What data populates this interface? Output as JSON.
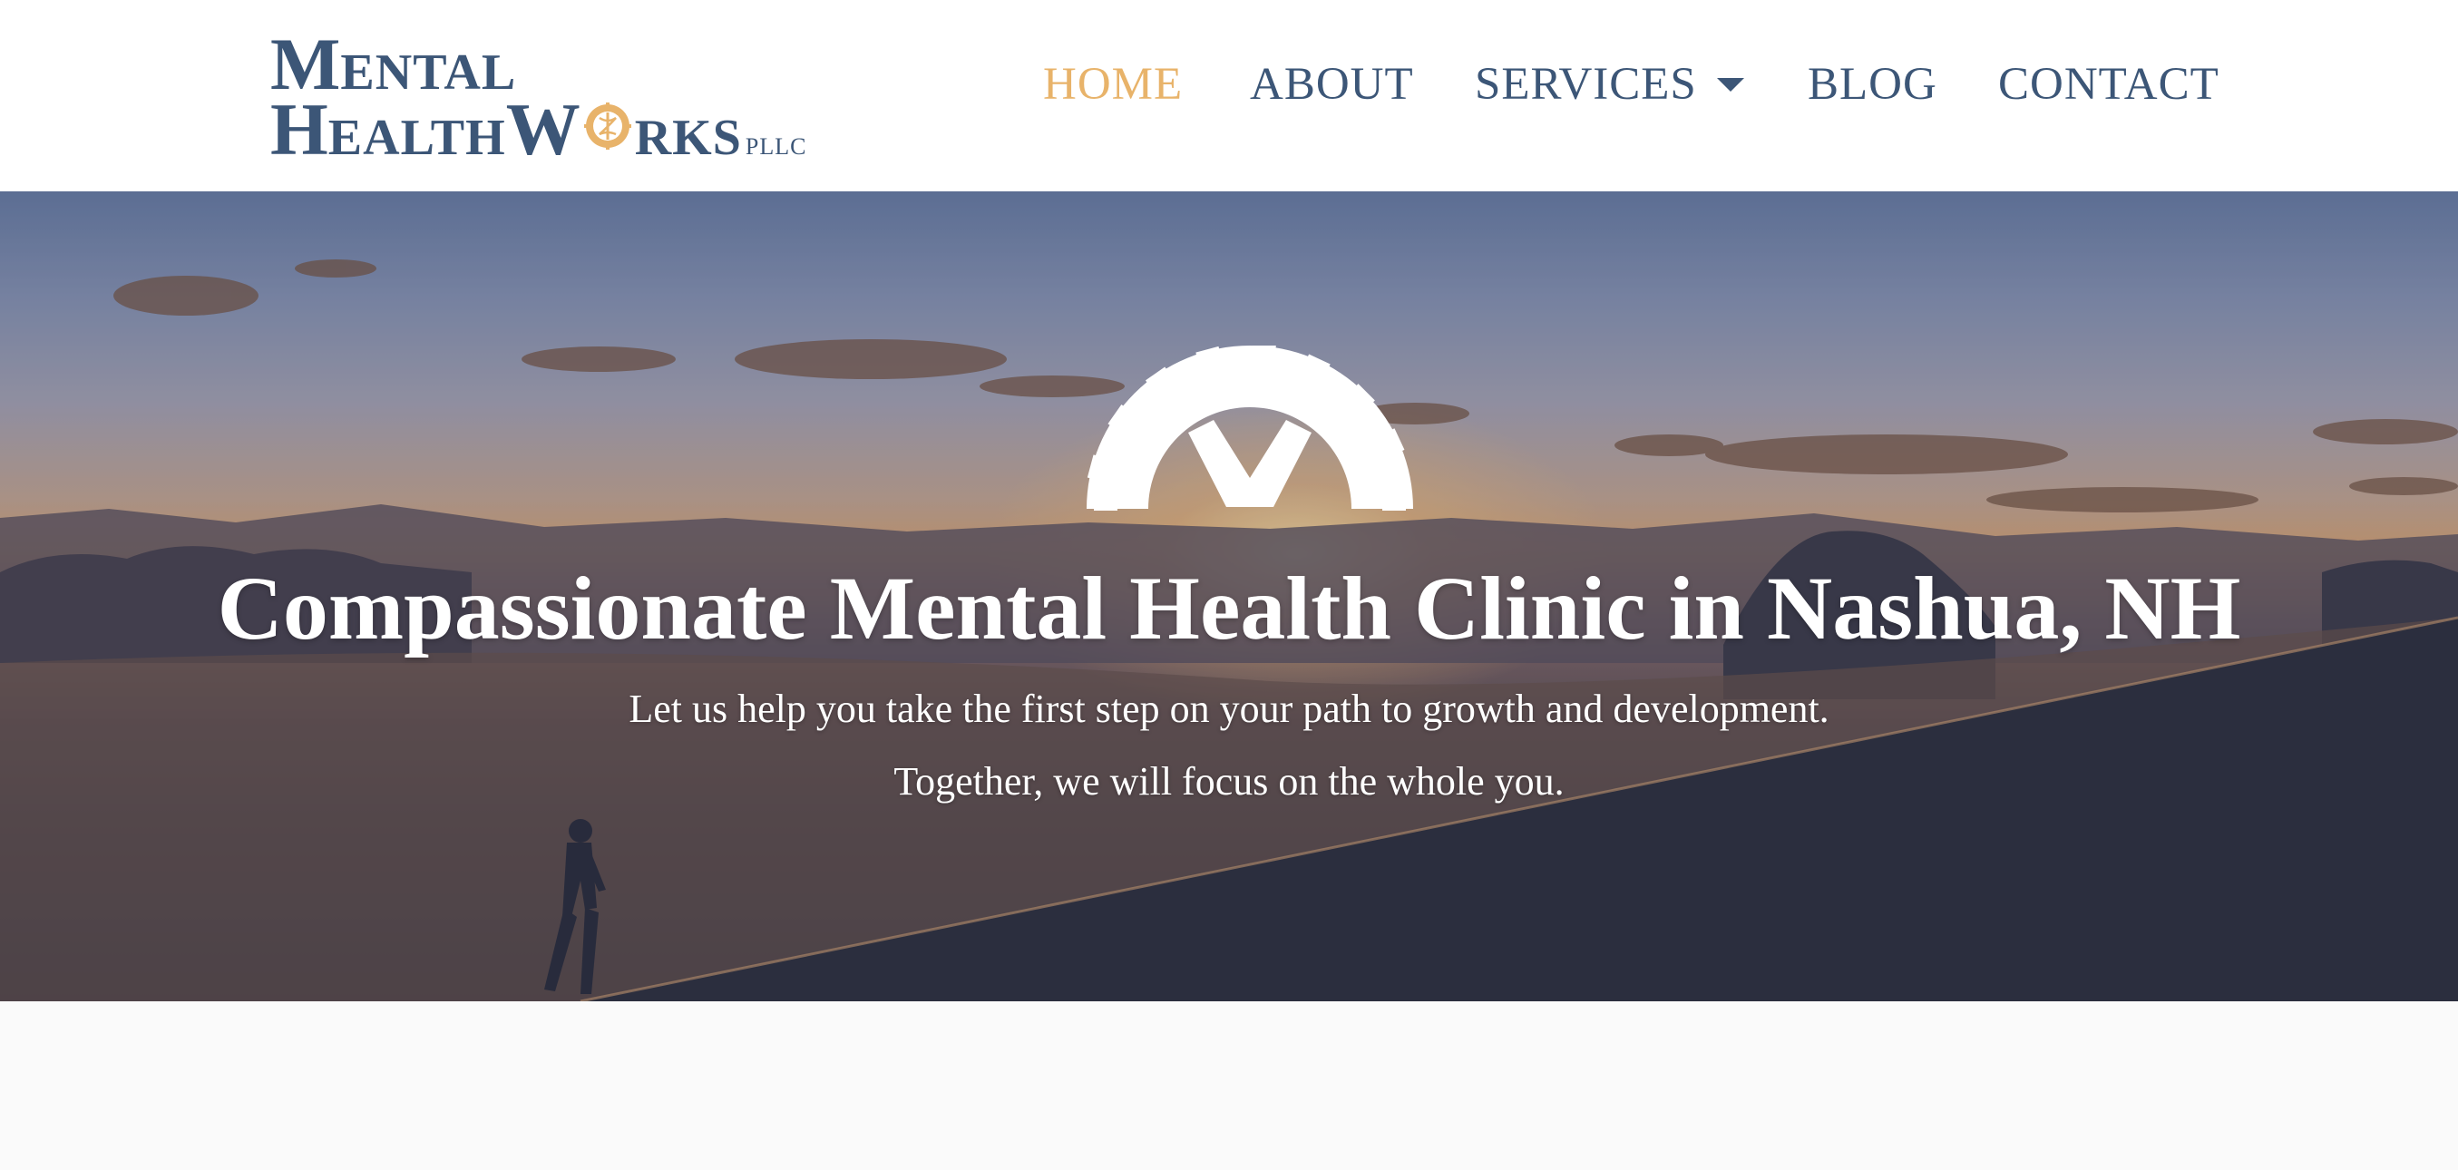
{
  "logo": {
    "line1_initial": "M",
    "line1_rest": "ENTAL",
    "line2_initial": "H",
    "line2_rest": "EALTH",
    "line2_w": "W",
    "line2_tail": "RKS",
    "suffix": "PLLC"
  },
  "nav": {
    "items": [
      {
        "label": "HOME",
        "active": true
      },
      {
        "label": "ABOUT"
      },
      {
        "label": "SERVICES",
        "has_dropdown": true
      },
      {
        "label": "BLOG"
      },
      {
        "label": "CONTACT"
      }
    ]
  },
  "hero": {
    "title": "Compassionate Mental Health Clinic in Nashua, NH",
    "subtitle_line1": "Let us help you take the first step on your path to growth and development.",
    "subtitle_line2": "Together, we will focus on the whole you."
  },
  "colors": {
    "brand": "#3c5677",
    "accent": "#e8b36a",
    "header_bg": "#ffffff",
    "page_bg": "#fafafa"
  },
  "icons": {
    "logo_o": "gear-caduceus-icon",
    "hero": "gear-icon",
    "dropdown": "caret-down-icon"
  }
}
